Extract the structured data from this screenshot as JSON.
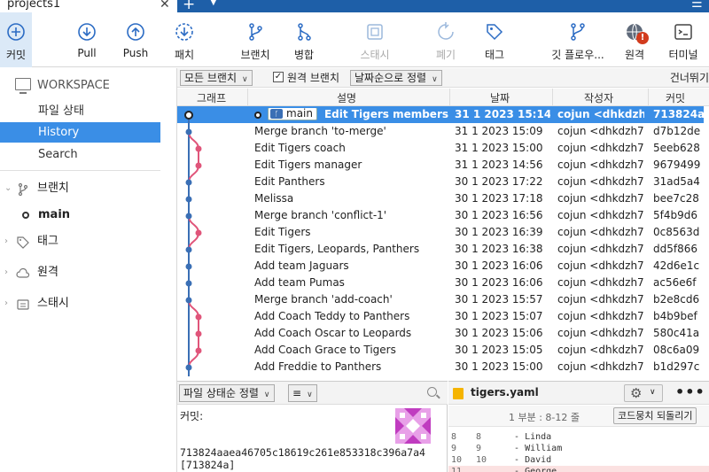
{
  "window": {
    "title": "projects1"
  },
  "toolbar": {
    "commit": "커밋",
    "pull": "Pull",
    "push": "Push",
    "patch": "패치",
    "branch": "브랜치",
    "merge": "병합",
    "stash": "스태시",
    "discard": "폐기",
    "tag": "태그",
    "git_flow": "깃 플로우...",
    "remote": "원격",
    "terminal": "터미널",
    "remote_badge": "!"
  },
  "sidebar": {
    "workspace": "WORKSPACE",
    "items": [
      {
        "label": "파일 상태",
        "selected": false
      },
      {
        "label": "History",
        "selected": true
      },
      {
        "label": "Search",
        "selected": false
      }
    ],
    "branches_label": "브랜치",
    "current_branch": "main",
    "tags_label": "태그",
    "remotes_label": "원격",
    "stashes_label": "스태시"
  },
  "filters": {
    "branch_filter": "모든 브랜치",
    "remote_branches_label": "원격 브랜치",
    "remote_branches_checked": true,
    "sort": "날짜순으로 정렬",
    "skip": "건너뛰기"
  },
  "columns": {
    "graph": "그래프",
    "description": "설명",
    "date": "날짜",
    "author": "작성자",
    "commit": "커밋"
  },
  "commits": [
    {
      "msg": "Edit Tigers members",
      "date": "31 1 2023 15:14",
      "author": "cojun <dhkdzh70",
      "hash": "713824a",
      "selected": true,
      "branch_tag": "main"
    },
    {
      "msg": "Merge branch 'to-merge'",
      "date": "31 1 2023 15:09",
      "author": "cojun <dhkdzh70",
      "hash": "d7b12de"
    },
    {
      "msg": "Edit Tigers coach",
      "date": "31 1 2023 15:00",
      "author": "cojun <dhkdzh70",
      "hash": "5eeb628"
    },
    {
      "msg": "Edit Tigers manager",
      "date": "31 1 2023 14:56",
      "author": "cojun <dhkdzh70",
      "hash": "9679499"
    },
    {
      "msg": "Edit Panthers",
      "date": "30 1 2023 17:22",
      "author": "cojun <dhkdzh70",
      "hash": "31ad5a4"
    },
    {
      "msg": "Melissa",
      "date": "30 1 2023 17:18",
      "author": "cojun <dhkdzh70",
      "hash": "bee7c28"
    },
    {
      "msg": "Merge branch 'conflict-1'",
      "date": "30 1 2023 16:56",
      "author": "cojun <dhkdzh70",
      "hash": "5f4b9d6"
    },
    {
      "msg": "Edit Tigers",
      "date": "30 1 2023 16:39",
      "author": "cojun <dhkdzh70",
      "hash": "0c8563d"
    },
    {
      "msg": "Edit Tigers, Leopards, Panthers",
      "date": "30 1 2023 16:38",
      "author": "cojun <dhkdzh70",
      "hash": "dd5f866"
    },
    {
      "msg": "Add team Jaguars",
      "date": "30 1 2023 16:06",
      "author": "cojun <dhkdzh70",
      "hash": "42d6e1c"
    },
    {
      "msg": "Add team Pumas",
      "date": "30 1 2023 16:06",
      "author": "cojun <dhkdzh70",
      "hash": "ac56e6f"
    },
    {
      "msg": "Merge branch 'add-coach'",
      "date": "30 1 2023 15:57",
      "author": "cojun <dhkdzh70",
      "hash": "b2e8cd6"
    },
    {
      "msg": "Add Coach Teddy to Panthers",
      "date": "30 1 2023 15:07",
      "author": "cojun <dhkdzh70",
      "hash": "b4b9bef"
    },
    {
      "msg": "Add Coach Oscar to Leopards",
      "date": "30 1 2023 15:06",
      "author": "cojun <dhkdzh70",
      "hash": "580c41a"
    },
    {
      "msg": "Add Coach Grace to Tigers",
      "date": "30 1 2023 15:05",
      "author": "cojun <dhkdzh70",
      "hash": "08c6a09"
    },
    {
      "msg": "Add Freddie to Panthers",
      "date": "30 1 2023 15:00",
      "author": "cojun <dhkdzh70",
      "hash": "b1d297c"
    }
  ],
  "file_panel": {
    "sort": "파일 상태순 정렬",
    "view_icon": "≡"
  },
  "details": {
    "commit_label": "커밋:",
    "full_hash": "713824aaea46705c18619c261e853318c396a7a4",
    "short_hash": "[713824a]"
  },
  "diff": {
    "file": "tigers.yaml",
    "hunk": "1 부분 : 8-12 줄",
    "revert": "코드뭉치 되돌리기",
    "lines": [
      {
        "old": "8",
        "new": "8",
        "text": "  - Linda",
        "type": "ctx"
      },
      {
        "old": "9",
        "new": "9",
        "text": "  - William",
        "type": "ctx"
      },
      {
        "old": "10",
        "new": "10",
        "text": "  - David",
        "type": "ctx"
      },
      {
        "old": "11",
        "new": "",
        "text": "  - George",
        "type": "del"
      }
    ]
  },
  "colors": {
    "accent": "#3a8ee6",
    "graph_blue": "#3a6fb5",
    "graph_pink": "#e0557a",
    "title_blue": "#1e5fa8"
  }
}
